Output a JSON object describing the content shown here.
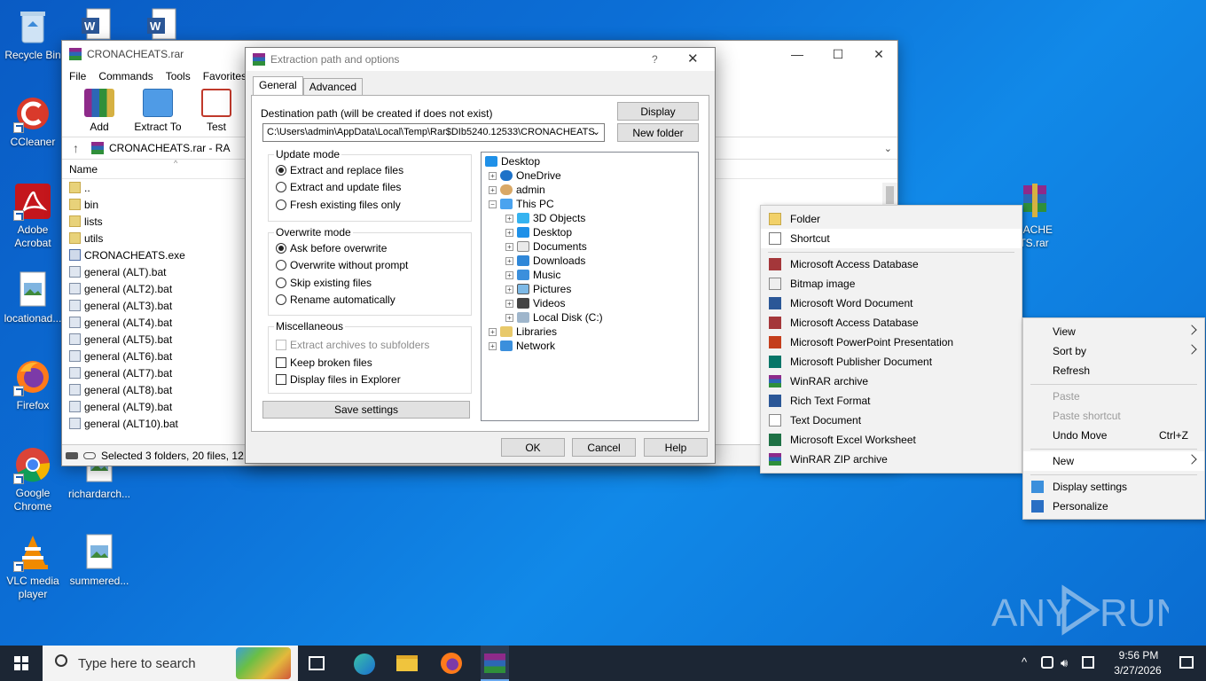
{
  "desktop": {
    "icons": [
      {
        "label": "Recycle Bin"
      },
      {
        "label": "CCleaner"
      },
      {
        "label": "Adobe Acrobat"
      },
      {
        "label": "locationad..."
      },
      {
        "label": "Firefox"
      },
      {
        "label": "Google Chrome"
      },
      {
        "label": "VLC media player"
      },
      {
        "label": "richardarch..."
      },
      {
        "label": "summered..."
      },
      {
        "label": "NACHE\nTS.rar"
      }
    ],
    "watermark": "ANY RUN"
  },
  "winrar": {
    "title": "CRONACHEATS.rar",
    "menu": [
      "File",
      "Commands",
      "Tools",
      "Favorites"
    ],
    "toolbar": [
      "Add",
      "Extract To",
      "Test",
      "Vi"
    ],
    "address": "CRONACHEATS.rar - RA",
    "column_name": "Name",
    "files": [
      {
        "name": "..",
        "type": "folder"
      },
      {
        "name": "bin",
        "type": "folder"
      },
      {
        "name": "lists",
        "type": "folder"
      },
      {
        "name": "utils",
        "type": "folder"
      },
      {
        "name": "CRONACHEATS.exe",
        "type": "exe"
      },
      {
        "name": "general (ALT).bat",
        "type": "bat"
      },
      {
        "name": "general (ALT2).bat",
        "type": "bat"
      },
      {
        "name": "general (ALT3).bat",
        "type": "bat"
      },
      {
        "name": "general (ALT4).bat",
        "type": "bat"
      },
      {
        "name": "general (ALT5).bat",
        "type": "bat"
      },
      {
        "name": "general (ALT6).bat",
        "type": "bat"
      },
      {
        "name": "general (ALT7).bat",
        "type": "bat"
      },
      {
        "name": "general (ALT8).bat",
        "type": "bat"
      },
      {
        "name": "general (ALT9).bat",
        "type": "bat"
      },
      {
        "name": "general (ALT10).bat",
        "type": "bat"
      }
    ],
    "status": "Selected 3 folders, 20 files, 12,5"
  },
  "dialog": {
    "title": "Extraction path and options",
    "help_glyph": "?",
    "tabs": [
      "General",
      "Advanced"
    ],
    "dest_label": "Destination path (will be created if does not exist)",
    "dest_value": "C:\\Users\\admin\\AppData\\Local\\Temp\\Rar$DIb5240.12533\\CRONACHEATS",
    "display_btn": "Display",
    "new_folder_btn": "New folder",
    "update_mode": {
      "title": "Update mode",
      "options": [
        "Extract and replace files",
        "Extract and update files",
        "Fresh existing files only"
      ]
    },
    "overwrite_mode": {
      "title": "Overwrite mode",
      "options": [
        "Ask before overwrite",
        "Overwrite without prompt",
        "Skip existing files",
        "Rename automatically"
      ]
    },
    "misc": {
      "title": "Miscellaneous",
      "options": [
        "Extract archives to subfolders",
        "Keep broken files",
        "Display files in Explorer"
      ]
    },
    "save_settings": "Save settings",
    "tree": [
      "Desktop",
      "OneDrive",
      "admin",
      "This PC",
      "3D Objects",
      "Desktop",
      "Documents",
      "Downloads",
      "Music",
      "Pictures",
      "Videos",
      "Local Disk (C:)",
      "Libraries",
      "Network"
    ],
    "ok": "OK",
    "cancel": "Cancel",
    "help": "Help"
  },
  "context_menu": {
    "items": [
      "View",
      "Sort by",
      "Refresh",
      "Paste",
      "Paste shortcut",
      "Undo Move",
      "New",
      "Display settings",
      "Personalize"
    ],
    "undo_shortcut": "Ctrl+Z"
  },
  "new_submenu": {
    "items": [
      "Folder",
      "Shortcut",
      "Microsoft Access Database",
      "Bitmap image",
      "Microsoft Word Document",
      "Microsoft Access Database",
      "Microsoft PowerPoint Presentation",
      "Microsoft Publisher Document",
      "WinRAR archive",
      "Rich Text Format",
      "Text Document",
      "Microsoft Excel Worksheet",
      "WinRAR ZIP archive"
    ]
  },
  "taskbar": {
    "search_placeholder": "Type here to search",
    "time": "9:56 PM",
    "date": "3/27/2026"
  }
}
